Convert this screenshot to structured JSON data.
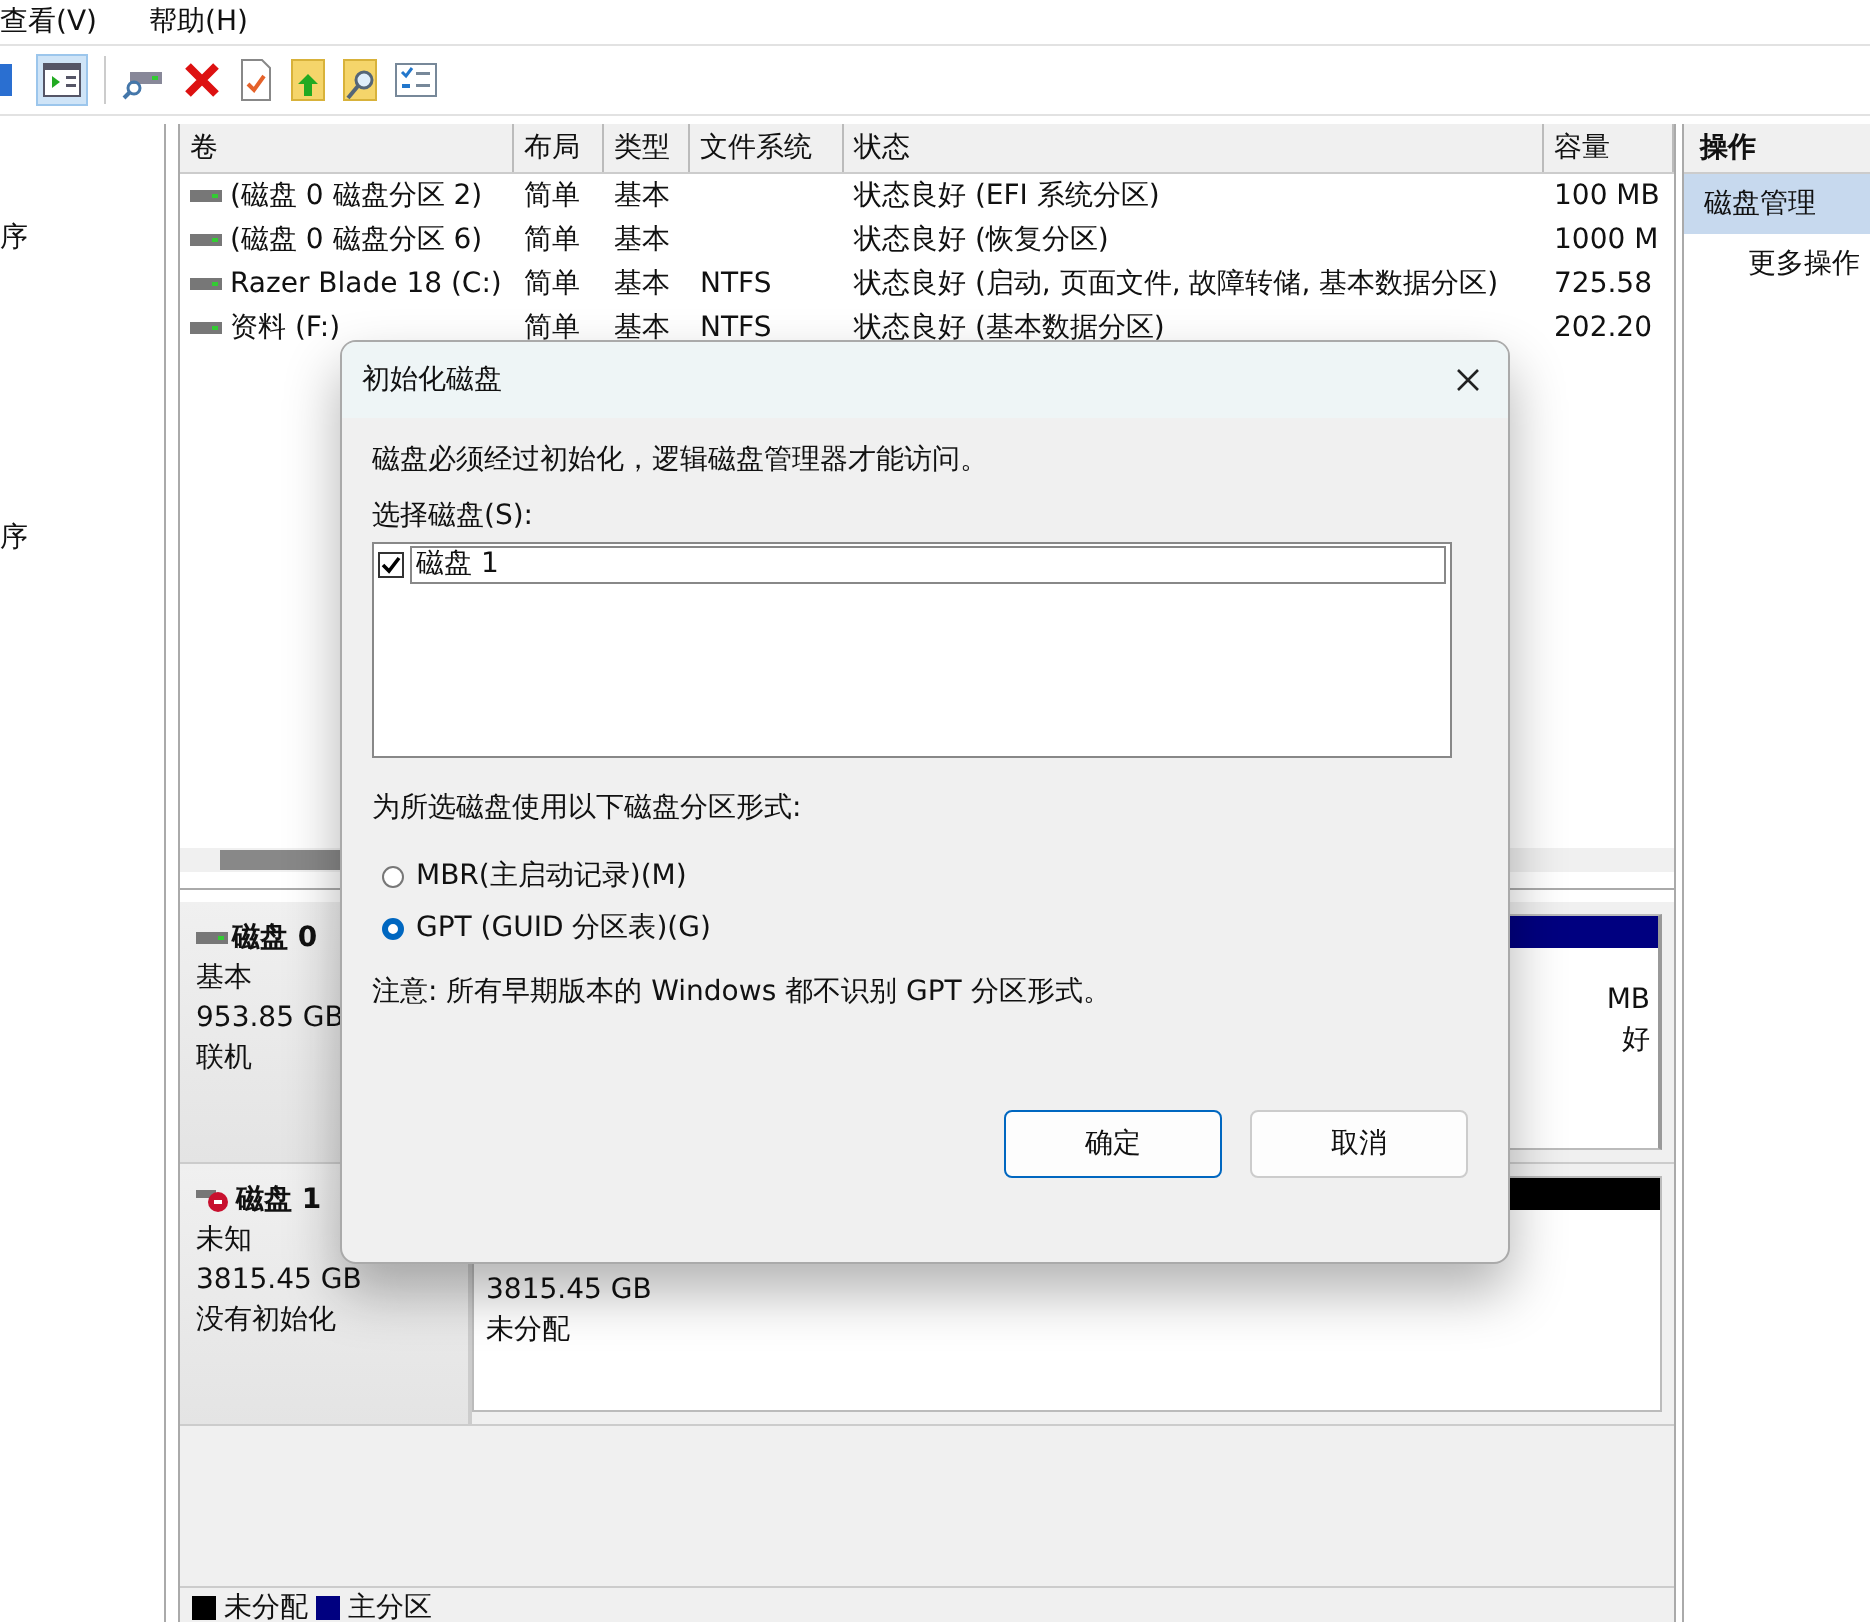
{
  "menu": [
    "查看(V)",
    "帮助(H)"
  ],
  "nav_items": [
    "序",
    "序"
  ],
  "table": {
    "columns": [
      "卷",
      "布局",
      "类型",
      "文件系统",
      "状态",
      "容量"
    ],
    "rows": [
      [
        "(磁盘 0 磁盘分区 2)",
        "简单",
        "基本",
        "",
        "状态良好 (EFI 系统分区)",
        "100 MB"
      ],
      [
        "(磁盘 0 磁盘分区 6)",
        "简单",
        "基本",
        "",
        "状态良好 (恢复分区)",
        "1000 M"
      ],
      [
        "Razer Blade 18 (C:)",
        "简单",
        "基本",
        "NTFS",
        "状态良好 (启动, 页面文件, 故障转储, 基本数据分区)",
        "725.58"
      ],
      [
        "资料 (F:)",
        "简单",
        "基本",
        "NTFS",
        "状态良好 (基本数据分区)",
        "202.20"
      ]
    ]
  },
  "actions": {
    "title": "操作",
    "items": [
      {
        "label": "磁盘管理",
        "selected": true
      },
      {
        "label": "更多操作",
        "selected": false
      }
    ]
  },
  "disks": [
    {
      "name": "磁盘 0",
      "kind": "online",
      "type": "基本",
      "size": "953.85 GB",
      "status": "联机",
      "partitions": [
        {
          "size": "MB",
          "label": "好",
          "color": "#000080"
        }
      ]
    },
    {
      "name": "磁盘 1",
      "kind": "uninitialized",
      "type": "未知",
      "size": "3815.45 GB",
      "status": "没有初始化",
      "partitions": [
        {
          "size": "3815.45 GB",
          "label": "未分配",
          "color": "#000000"
        }
      ]
    }
  ],
  "legend": [
    {
      "label": "未分配",
      "color": "#000000"
    },
    {
      "label": "主分区",
      "color": "#000080"
    }
  ],
  "dialog": {
    "title": "初始化磁盘",
    "message": "磁盘必须经过初始化，逻辑磁盘管理器才能访问。",
    "select_label": "选择磁盘(S):",
    "disks": [
      {
        "label": "磁盘 1",
        "checked": true
      }
    ],
    "style_label": "为所选磁盘使用以下磁盘分区形式:",
    "options": [
      {
        "label": "MBR(主启动记录)(M)",
        "selected": false
      },
      {
        "label": "GPT (GUID 分区表)(G)",
        "selected": true
      }
    ],
    "note": "注意: 所有早期版本的 Windows 都不识别 GPT 分区形式。",
    "buttons": [
      "确定",
      "取消"
    ]
  }
}
